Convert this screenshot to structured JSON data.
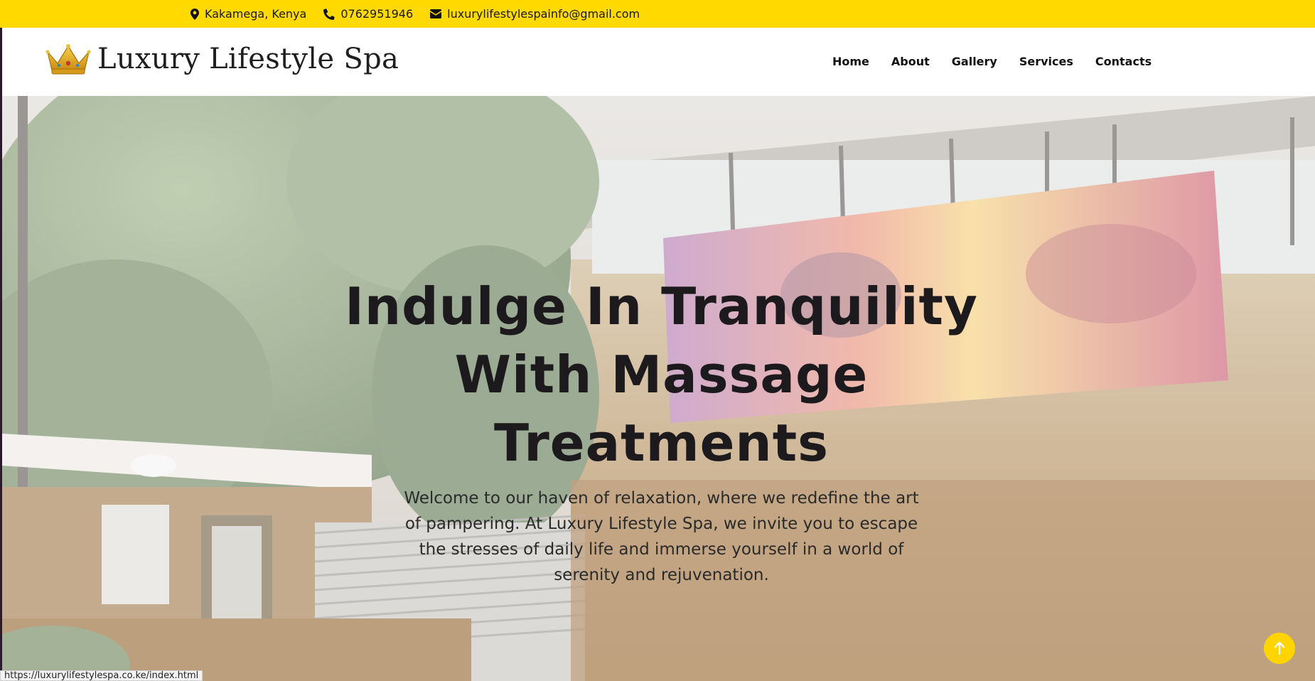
{
  "topbar": {
    "location": "Kakamega, Kenya",
    "phone": "0762951946",
    "email": "luxurylifestylespainfo@gmail.com",
    "location_icon": "map-marker-icon",
    "phone_icon": "phone-icon",
    "email_icon": "envelope-icon"
  },
  "brand": {
    "name": "Luxury Lifestyle Spa",
    "logo_icon": "crown-icon"
  },
  "nav": {
    "items": [
      "Home",
      "About",
      "Gallery",
      "Services",
      "Contacts"
    ]
  },
  "hero": {
    "title_line1": "Indulge In Tranquility",
    "title_line2": "With Massage",
    "title_line3": "Treatments",
    "description": "Welcome to our haven of relaxation, where we redefine the art of pampering. At Luxury Lifestyle Spa, we invite you to escape the stresses of daily life and immerse yourself in a world of serenity and rejuvenation."
  },
  "status_bar": {
    "url": "https://luxurylifestylespa.co.ke/index.html"
  },
  "scroll_top": {
    "icon": "arrow-up-icon"
  },
  "colors": {
    "accent": "#ffd900",
    "text": "#1c1a1c"
  }
}
